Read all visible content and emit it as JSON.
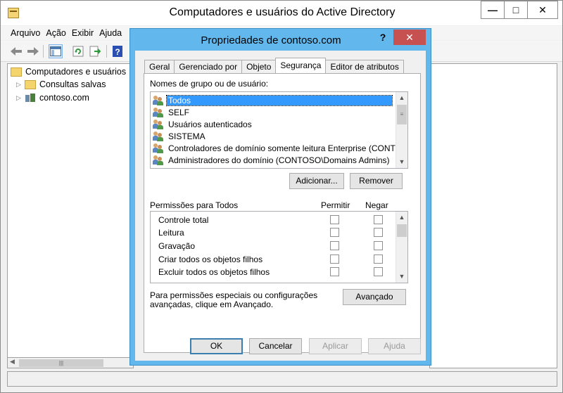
{
  "main_window": {
    "title": "Computadores e usuários do Active Directory",
    "window_buttons": {
      "minimize": "—",
      "maximize": "□",
      "close": "✕"
    },
    "menu": [
      "Arquivo",
      "Ação",
      "Exibir",
      "Ajuda"
    ],
    "toolbar_icons": [
      "back-icon",
      "forward-icon",
      "show-hide-console-tree-icon",
      "refresh-icon",
      "export-list-icon",
      "help-icon"
    ],
    "tree": {
      "root": "Computadores e usuários",
      "items": [
        {
          "label": "Consultas salvas",
          "icon": "folder-icon"
        },
        {
          "label": "contoso.com",
          "icon": "domain-icon"
        }
      ]
    }
  },
  "dialog": {
    "title": "Propriedades de contoso.com",
    "help_button": "?",
    "close_button": "✕",
    "tabs": [
      "Geral",
      "Gerenciado por",
      "Objeto",
      "Segurança",
      "Editor de atributos"
    ],
    "active_tab": "Segurança",
    "users_label": "Nomes de grupo ou de usuário:",
    "users": [
      {
        "name": "Todos",
        "selected": true
      },
      {
        "name": "SELF"
      },
      {
        "name": "Usuários autenticados"
      },
      {
        "name": "SISTEMA"
      },
      {
        "name": "Controladores de domínio somente leitura Enterprise (CONTOSO"
      },
      {
        "name": "Administradores do domínio (CONTOSO\\Domains Admins)"
      }
    ],
    "add_button": "Adicionar...",
    "remove_button": "Remover",
    "permissions_label": "Permissões para Todos",
    "allow_header": "Permitir",
    "deny_header": "Negar",
    "permissions": [
      {
        "name": "Controle total",
        "allow": false,
        "deny": false
      },
      {
        "name": "Leitura",
        "allow": false,
        "deny": false
      },
      {
        "name": "Gravação",
        "allow": false,
        "deny": false
      },
      {
        "name": "Criar todos os objetos filhos",
        "allow": false,
        "deny": false
      },
      {
        "name": "Excluir todos os objetos filhos",
        "allow": false,
        "deny": false
      }
    ],
    "advanced_text_line1": "Para permissões especiais ou configurações",
    "advanced_text_line2": "avançadas, clique em Avançado.",
    "advanced_button": "Avançado",
    "footer": {
      "ok": "OK",
      "cancel": "Cancelar",
      "apply": "Aplicar",
      "help": "Ajuda"
    }
  }
}
